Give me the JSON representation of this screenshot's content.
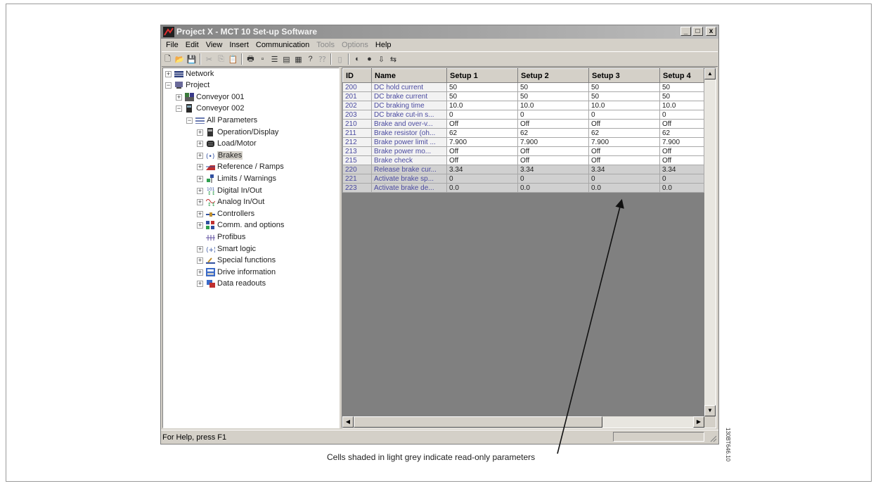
{
  "window": {
    "title": "Project X - MCT 10 Set-up Software"
  },
  "title_buttons": [
    "_",
    "□",
    "x"
  ],
  "menu": [
    {
      "label": "File",
      "enabled": true
    },
    {
      "label": "Edit",
      "enabled": true
    },
    {
      "label": "View",
      "enabled": true
    },
    {
      "label": "Insert",
      "enabled": true
    },
    {
      "label": "Communication",
      "enabled": true
    },
    {
      "label": "Tools",
      "enabled": false
    },
    {
      "label": "Options",
      "enabled": false
    },
    {
      "label": "Help",
      "enabled": true
    }
  ],
  "tree": [
    {
      "label": "Network",
      "icon": "network-icon"
    },
    {
      "label": "Project",
      "icon": "project-icon"
    },
    {
      "label": "Conveyor 001",
      "icon": "drive-icon"
    },
    {
      "label": "Conveyor 002",
      "icon": "drive-icon"
    },
    {
      "label": "All Parameters",
      "icon": "parameters-icon"
    },
    {
      "label": "Operation/Display",
      "icon": "display-icon"
    },
    {
      "label": "Load/Motor",
      "icon": "motor-icon"
    },
    {
      "label": "Brakes",
      "icon": "brakes-icon",
      "selected": true
    },
    {
      "label": "Reference / Ramps",
      "icon": "ramps-icon"
    },
    {
      "label": "Limits / Warnings",
      "icon": "limits-icon"
    },
    {
      "label": "Digital In/Out",
      "icon": "digital-io-icon"
    },
    {
      "label": "Analog In/Out",
      "icon": "analog-io-icon"
    },
    {
      "label": "Controllers",
      "icon": "controllers-icon"
    },
    {
      "label": "Comm. and options",
      "icon": "comm-icon"
    },
    {
      "label": "Profibus",
      "icon": "profibus-icon"
    },
    {
      "label": "Smart logic",
      "icon": "smart-logic-icon"
    },
    {
      "label": "Special functions",
      "icon": "special-functions-icon"
    },
    {
      "label": "Drive information",
      "icon": "drive-info-icon"
    },
    {
      "label": "Data readouts",
      "icon": "data-readouts-icon"
    }
  ],
  "grid": {
    "headers": [
      "ID",
      "Name",
      "Setup 1",
      "Setup 2",
      "Setup 3",
      "Setup 4"
    ],
    "rows": [
      {
        "id": "200",
        "name": "DC hold current",
        "s1": "50",
        "s2": "50",
        "s3": "50",
        "s4": "50",
        "read_only": false
      },
      {
        "id": "201",
        "name": "DC brake current",
        "s1": "50",
        "s2": "50",
        "s3": "50",
        "s4": "50",
        "read_only": false
      },
      {
        "id": "202",
        "name": "DC braking time",
        "s1": "10.0",
        "s2": "10.0",
        "s3": "10.0",
        "s4": "10.0",
        "read_only": false
      },
      {
        "id": "203",
        "name": "DC brake cut-in s...",
        "s1": "0",
        "s2": "0",
        "s3": "0",
        "s4": "0",
        "read_only": false
      },
      {
        "id": "210",
        "name": "Brake and over-v...",
        "s1": "Off",
        "s2": "Off",
        "s3": "Off",
        "s4": "Off",
        "read_only": false
      },
      {
        "id": "211",
        "name": "Brake resistor (oh...",
        "s1": "62",
        "s2": "62",
        "s3": "62",
        "s4": "62",
        "read_only": false
      },
      {
        "id": "212",
        "name": "Brake power limit ...",
        "s1": "7.900",
        "s2": "7.900",
        "s3": "7.900",
        "s4": "7.900",
        "read_only": false
      },
      {
        "id": "213",
        "name": "Brake power mo...",
        "s1": "Off",
        "s2": "Off",
        "s3": "Off",
        "s4": "Off",
        "read_only": false
      },
      {
        "id": "215",
        "name": "Brake check",
        "s1": "Off",
        "s2": "Off",
        "s3": "Off",
        "s4": "Off",
        "read_only": false
      },
      {
        "id": "220",
        "name": "Release brake cur...",
        "s1": "3.34",
        "s2": "3.34",
        "s3": "3.34",
        "s4": "3.34",
        "read_only": true
      },
      {
        "id": "221",
        "name": "Activate brake sp...",
        "s1": "0",
        "s2": "0",
        "s3": "0",
        "s4": "0",
        "read_only": true
      },
      {
        "id": "223",
        "name": "Activate brake de...",
        "s1": "0.0",
        "s2": "0.0",
        "s3": "0.0",
        "s4": "0.0",
        "read_only": true
      }
    ]
  },
  "status_bar": {
    "text": "For Help, press F1"
  },
  "caption": "Cells shaded in light grey indicate read-only parameters",
  "doc_id": "130BT646.10",
  "colors": {
    "read_only_cell": "#d0d0d0",
    "id_text": "#4a4aa0",
    "title_gradient_start": "#848484"
  }
}
